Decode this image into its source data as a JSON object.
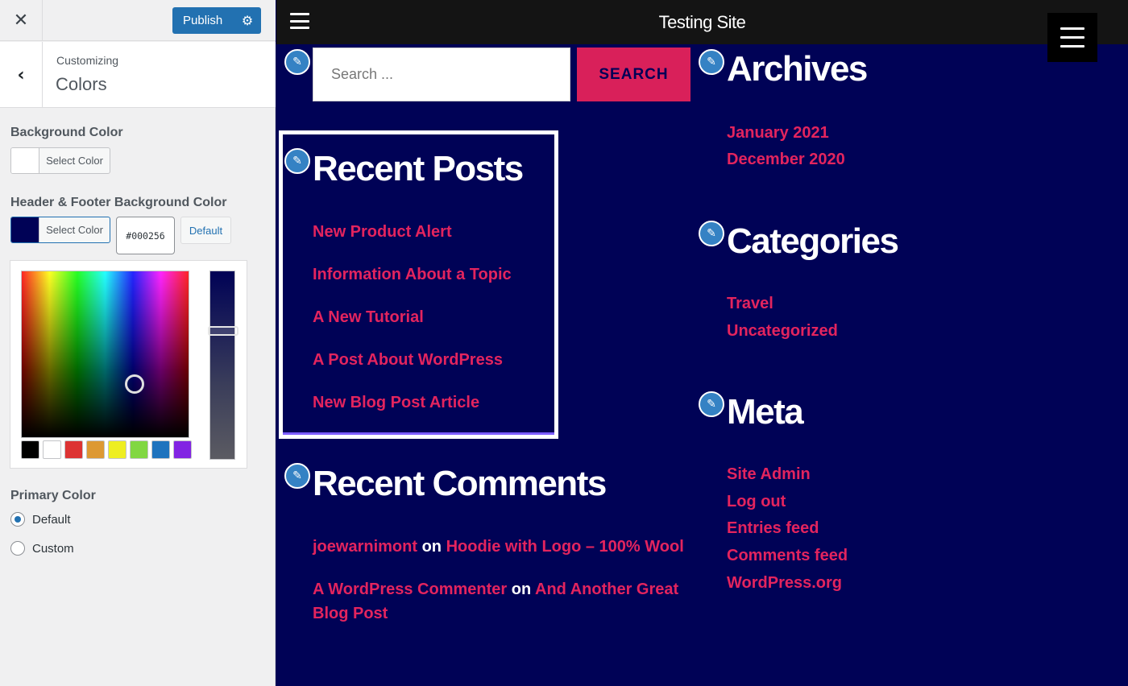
{
  "customizer": {
    "close_icon": "✕",
    "publish_label": "Publish",
    "publish_gear_icon": "⚙",
    "back_icon": "‹",
    "breadcrumb": "Customizing",
    "section_title": "Colors",
    "background_color": {
      "label": "Background Color",
      "button_label": "Select Color",
      "swatch_color": "#ffffff"
    },
    "header_footer_color": {
      "label": "Header & Footer Background Color",
      "button_label": "Select Color",
      "swatch_color": "#000256",
      "hex_value": "#000256",
      "default_label": "Default"
    },
    "palette": [
      "#000000",
      "#ffffff",
      "#dd3333",
      "#dd9933",
      "#eeee22",
      "#81d742",
      "#1e73be",
      "#8224e3"
    ],
    "primary_color": {
      "label": "Primary Color",
      "options": [
        {
          "label": "Default",
          "selected": true
        },
        {
          "label": "Custom",
          "selected": false
        }
      ]
    }
  },
  "preview": {
    "site_title": "Testing Site",
    "edit_icon": "✎",
    "search": {
      "placeholder": "Search ...",
      "button_label": "SEARCH"
    },
    "recent_posts": {
      "title": "Recent Posts",
      "items": [
        "New Product Alert",
        "Information About a Topic",
        "A New Tutorial",
        "A Post About WordPress",
        "New Blog Post Article"
      ]
    },
    "recent_comments": {
      "title": "Recent Comments",
      "items": [
        {
          "author": "joewarnimont",
          "connector": "on",
          "post": "Hoodie with Logo – 100% Wool"
        },
        {
          "author": "A WordPress Commenter",
          "connector": "on",
          "post_line1": "And Another Great",
          "post_line2": "Blog Post"
        }
      ]
    },
    "archives": {
      "title": "Archives",
      "items": [
        "January 2021",
        "December 2020"
      ]
    },
    "categories": {
      "title": "Categories",
      "items": [
        "Travel",
        "Uncategorized"
      ]
    },
    "meta": {
      "title": "Meta",
      "items": [
        "Site Admin",
        "Log out",
        "Entries feed",
        "Comments feed",
        "WordPress.org"
      ]
    },
    "colors": {
      "background": "#000256",
      "link": "#e3245e",
      "header": "#141414"
    }
  }
}
